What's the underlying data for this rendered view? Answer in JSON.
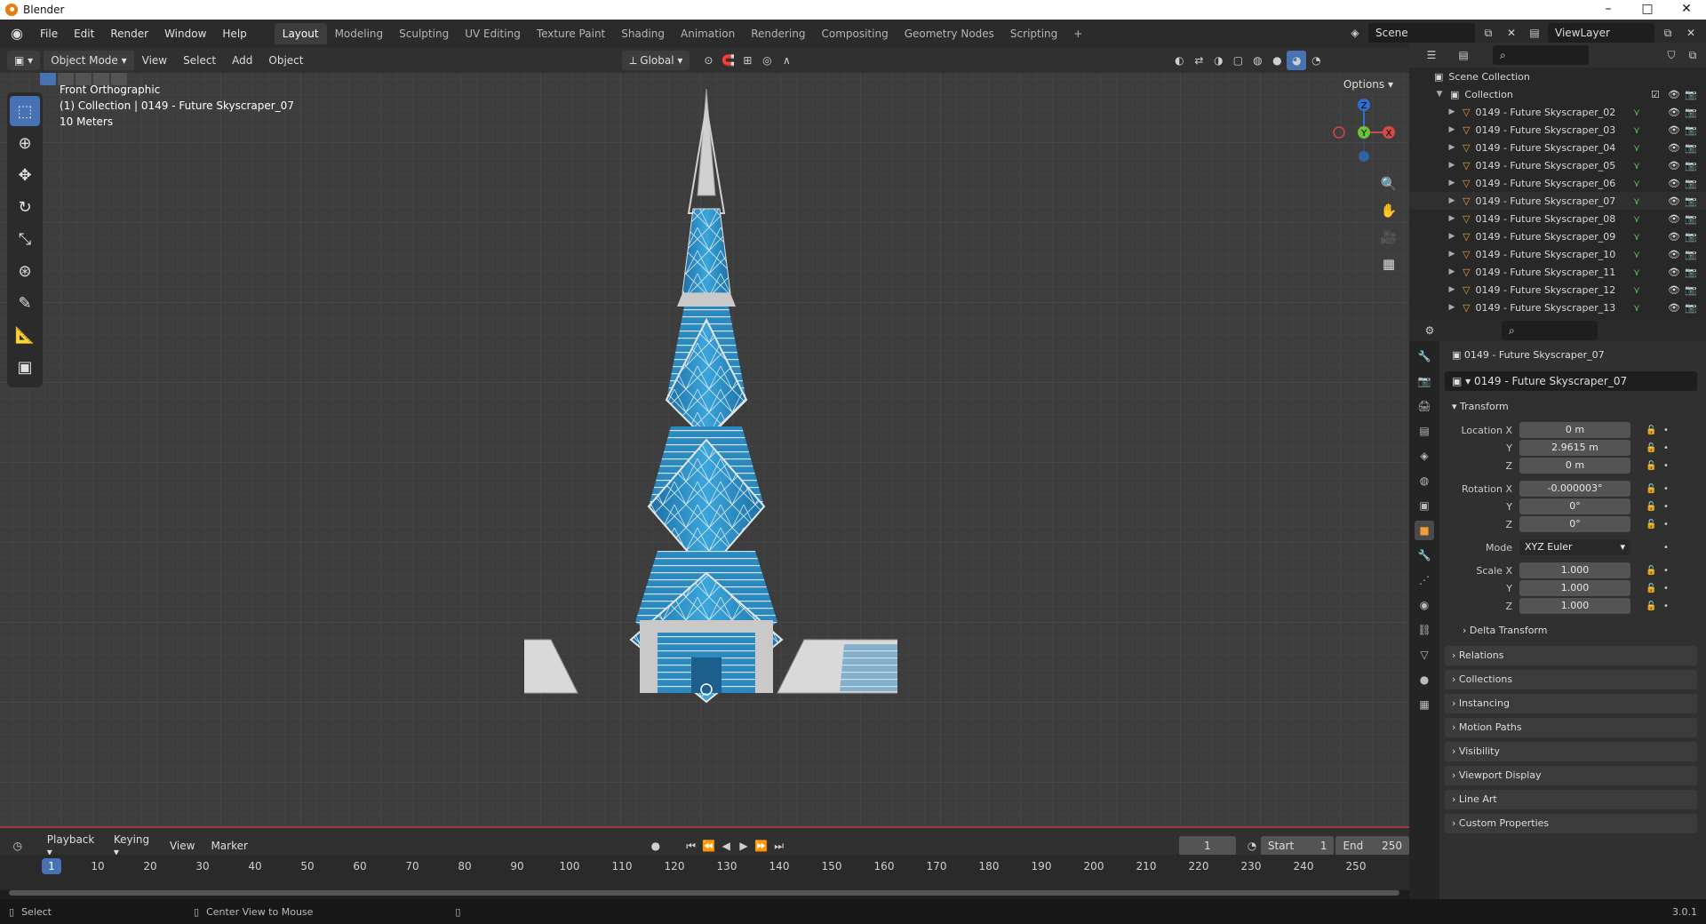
{
  "app": {
    "title": "Blender"
  },
  "menu": {
    "items": [
      "File",
      "Edit",
      "Render",
      "Window",
      "Help"
    ]
  },
  "workspaces": [
    "Layout",
    "Modeling",
    "Sculpting",
    "UV Editing",
    "Texture Paint",
    "Shading",
    "Animation",
    "Rendering",
    "Compositing",
    "Geometry Nodes",
    "Scripting"
  ],
  "active_workspace": "Layout",
  "scene": {
    "name": "Scene",
    "view_layer": "ViewLayer"
  },
  "viewport_header": {
    "mode": "Object Mode",
    "menus": [
      "View",
      "Select",
      "Add",
      "Object"
    ],
    "orientation": "Global",
    "options": "Options"
  },
  "viewport": {
    "view_name": "Front Orthographic",
    "collection_info": "(1) Collection | 0149 - Future Skyscraper_07",
    "scale": "10 Meters"
  },
  "gizmo": {
    "z": "Z",
    "y": "Y",
    "x": "X"
  },
  "outliner": {
    "scene_collection": "Scene Collection",
    "collection": "Collection",
    "objects": [
      "0149 - Future Skyscraper_02",
      "0149 - Future Skyscraper_03",
      "0149 - Future Skyscraper_04",
      "0149 - Future Skyscraper_05",
      "0149 - Future Skyscraper_06",
      "0149 - Future Skyscraper_07",
      "0149 - Future Skyscraper_08",
      "0149 - Future Skyscraper_09",
      "0149 - Future Skyscraper_10",
      "0149 - Future Skyscraper_11",
      "0149 - Future Skyscraper_12",
      "0149 - Future Skyscraper_13"
    ]
  },
  "properties": {
    "object_name": "0149 - Future Skyscraper_07",
    "data_name": "0149 - Future Skyscraper_07",
    "transform_title": "Transform",
    "location_label": "Location X",
    "loc_x": "0 m",
    "loc_y": "2.9615 m",
    "loc_z": "0 m",
    "rotation_label": "Rotation X",
    "rot_x": "-0.000003°",
    "rot_y": "0°",
    "rot_z": "0°",
    "mode_label": "Mode",
    "mode": "XYZ Euler",
    "scale_label": "Scale X",
    "scale_x": "1.000",
    "scale_y": "1.000",
    "scale_z": "1.000",
    "y_label": "Y",
    "z_label": "Z",
    "delta": "Delta Transform",
    "panels": [
      "Relations",
      "Collections",
      "Instancing",
      "Motion Paths",
      "Visibility",
      "Viewport Display",
      "Line Art",
      "Custom Properties"
    ]
  },
  "timeline": {
    "menus": [
      "Playback",
      "Keying",
      "View",
      "Marker"
    ],
    "current": "1",
    "start_label": "Start",
    "start": "1",
    "end_label": "End",
    "end": "250",
    "ticks": [
      "10",
      "20",
      "30",
      "40",
      "50",
      "60",
      "70",
      "80",
      "90",
      "100",
      "110",
      "120",
      "130",
      "140",
      "150",
      "160",
      "170",
      "180",
      "190",
      "200",
      "210",
      "220",
      "230",
      "240",
      "250"
    ]
  },
  "status": {
    "select": "Select",
    "center": "Center View to Mouse",
    "version": "3.0.1"
  },
  "colors": {
    "accent": "#4772b3",
    "glass": "#2f8fc4",
    "frame": "#c9c9c9"
  }
}
